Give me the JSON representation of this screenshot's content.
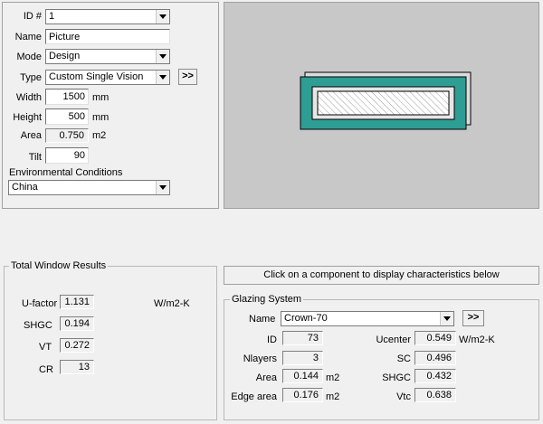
{
  "id_field": {
    "label": "ID #",
    "value": "1"
  },
  "name_field": {
    "label": "Name",
    "value": "Picture"
  },
  "mode_field": {
    "label": "Mode",
    "value": "Design"
  },
  "type_field": {
    "label": "Type",
    "value": "Custom Single Vision",
    "expand_label": ">>"
  },
  "width_field": {
    "label": "Width",
    "value": "1500",
    "unit": "mm"
  },
  "height_field": {
    "label": "Height",
    "value": "500",
    "unit": "mm"
  },
  "area_field": {
    "label": "Area",
    "value": "0.750",
    "unit": "m2"
  },
  "tilt_field": {
    "label": "Tilt",
    "value": "90"
  },
  "env": {
    "label": "Environmental Conditions",
    "value": "China"
  },
  "preview_colors": {
    "frame": "#2e9d94",
    "background": "#c8c8c8"
  },
  "results": {
    "title": "Total Window Results",
    "ufactor": {
      "label": "U-factor",
      "value": "1.131",
      "unit": "W/m2-K"
    },
    "shgc": {
      "label": "SHGC",
      "value": "0.194"
    },
    "vt": {
      "label": "VT",
      "value": "0.272"
    },
    "cr": {
      "label": "CR",
      "value": "13"
    }
  },
  "component_hint": "Click on a component to display characteristics below",
  "glazing": {
    "title": "Glazing System",
    "name_label": "Name",
    "name_value": "Crown-70",
    "expand_label": ">>",
    "id": {
      "label": "ID",
      "value": "73"
    },
    "nlayers": {
      "label": "Nlayers",
      "value": "3"
    },
    "area": {
      "label": "Area",
      "value": "0.144",
      "unit": "m2"
    },
    "edge_area": {
      "label": "Edge area",
      "value": "0.176",
      "unit": "m2"
    },
    "ucenter": {
      "label": "Ucenter",
      "value": "0.549",
      "unit": "W/m2-K"
    },
    "sc": {
      "label": "SC",
      "value": "0.496"
    },
    "shgc": {
      "label": "SHGC",
      "value": "0.432"
    },
    "vtc": {
      "label": "Vtc",
      "value": "0.638"
    }
  }
}
